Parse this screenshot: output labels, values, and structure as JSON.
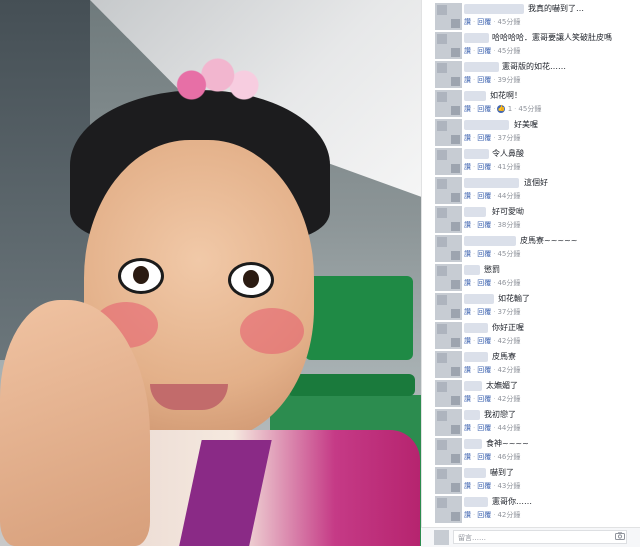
{
  "comments": [
    {
      "text": "我真的嚇到了…",
      "reply_label": "回覆",
      "time": "45分鐘",
      "like_count": ""
    },
    {
      "text": "哈哈哈哈．憲哥要讓人笑破肚皮嗎",
      "reply_label": "回覆",
      "time": "45分鐘",
      "like_count": ""
    },
    {
      "text": "憲哥版的如花……",
      "reply_label": "回覆",
      "time": "39分鐘",
      "like_count": ""
    },
    {
      "text": "如花啊！",
      "reply_label": "回覆",
      "time": "45分鐘",
      "like_count": "1"
    },
    {
      "text": "好美喔",
      "reply_label": "回覆",
      "time": "37分鐘",
      "like_count": ""
    },
    {
      "text": "令人鼻酸",
      "reply_label": "回覆",
      "time": "41分鐘",
      "like_count": ""
    },
    {
      "text": "這個好",
      "reply_label": "回覆",
      "time": "44分鐘",
      "like_count": ""
    },
    {
      "text": "好可愛呦",
      "reply_label": "回覆",
      "time": "38分鐘",
      "like_count": ""
    },
    {
      "text": "皮馬寮~~~~~",
      "reply_label": "回覆",
      "time": "45分鐘",
      "like_count": ""
    },
    {
      "text": "懲罰",
      "reply_label": "回覆",
      "time": "46分鐘",
      "like_count": ""
    },
    {
      "text": "如花輸了",
      "reply_label": "回覆",
      "time": "37分鐘",
      "like_count": ""
    },
    {
      "text": "你好正喔",
      "reply_label": "回覆",
      "time": "42分鐘",
      "like_count": ""
    },
    {
      "text": "皮馬寮",
      "reply_label": "回覆",
      "time": "42分鐘",
      "like_count": ""
    },
    {
      "text": "太嫵媚了",
      "reply_label": "回覆",
      "time": "42分鐘",
      "like_count": ""
    },
    {
      "text": "我初戀了",
      "reply_label": "回覆",
      "time": "44分鐘",
      "like_count": ""
    },
    {
      "text": "食神~~~~",
      "reply_label": "回覆",
      "time": "46分鐘",
      "like_count": ""
    },
    {
      "text": "嚇到了",
      "reply_label": "回覆",
      "time": "43分鐘",
      "like_count": ""
    },
    {
      "text": "憲哥你……",
      "reply_label": "回覆",
      "time": "42分鐘",
      "like_count": ""
    }
  ],
  "like_label": "讚",
  "composer": {
    "placeholder": "留言……",
    "camera_icon": "camera-icon"
  }
}
